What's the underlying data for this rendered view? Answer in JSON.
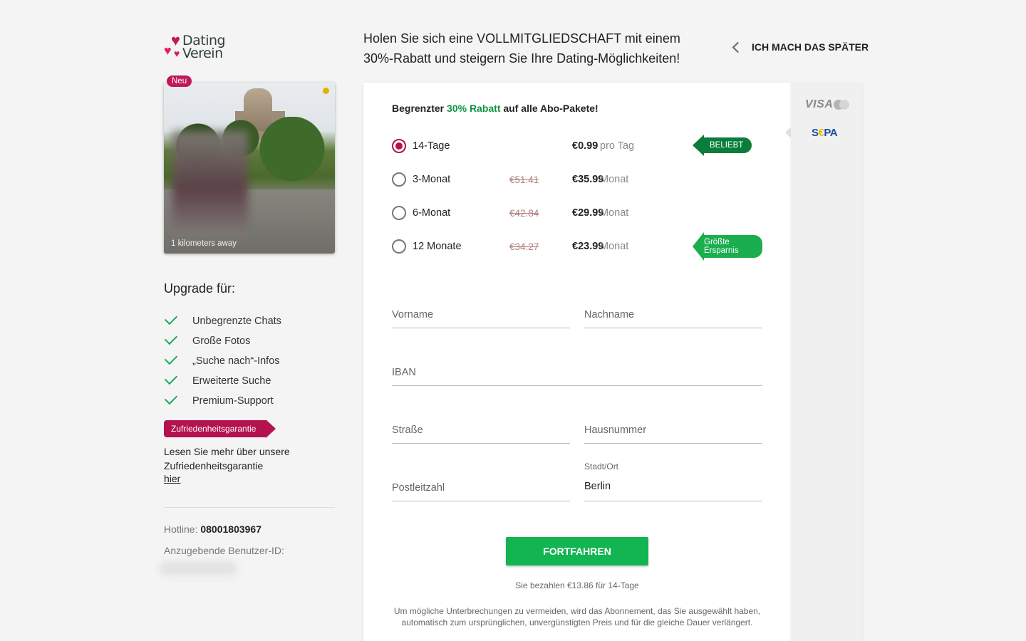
{
  "brand": {
    "logo_text_line1": "Dating",
    "logo_text_line2": "Verein"
  },
  "profile": {
    "badge": "Neu",
    "distance": "1 kilometers away"
  },
  "upgrade": {
    "title": "Upgrade für:",
    "features": [
      "Unbegrenzte Chats",
      "Große Fotos",
      "„Suche nach“-Infos",
      "Erweiterte Suche",
      "Premium-Support"
    ],
    "guarantee_badge": "Zufriedenheitsgarantie",
    "guarantee_text": "Lesen Sie mehr über unsere Zufriedenheitsgarantie",
    "guarantee_link": "hier"
  },
  "contact": {
    "hotline_label": "Hotline:",
    "hotline_number": "08001803967",
    "user_id_label": "Anzugebende Benutzer-ID:"
  },
  "header": {
    "headline": "Holen Sie sich eine VOLLMITGLIEDSCHAFT mit einem 30%-Rabatt und steigern Sie Ihre Dating-Möglichkeiten!",
    "later_button": "ICH MACH DAS SPÄTER"
  },
  "promo": {
    "prefix": "Begrenzter ",
    "highlight": "30% Rabatt",
    "suffix": " auf alle Abo-Pakete!"
  },
  "plans": [
    {
      "name": "14-Tage",
      "old_price": "",
      "price": "€0.99",
      "unit": "pro Tag",
      "selected": true
    },
    {
      "name": "3-Monat",
      "old_price": "€51.41",
      "price": "€35.99",
      "unit": "Monat",
      "selected": false
    },
    {
      "name": "6-Monat",
      "old_price": "€42.84",
      "price": "€29.99",
      "unit": "Monat",
      "selected": false
    },
    {
      "name": "12 Monate",
      "old_price": "€34.27",
      "price": "€23.99",
      "unit": "Monat",
      "selected": false
    }
  ],
  "tags": {
    "popular": "BELIEBT",
    "savings_line1": "Größte",
    "savings_line2": "Ersparnis"
  },
  "payment_methods": {
    "visa": "VISA",
    "sepa_s": "S",
    "sepa_euro": "€",
    "sepa_rest": "PA"
  },
  "form": {
    "first_name_placeholder": "Vorname",
    "last_name_placeholder": "Nachname",
    "iban_placeholder": "IBAN",
    "street_placeholder": "Straße",
    "house_number_placeholder": "Hausnummer",
    "postal_code_placeholder": "Postleitzahl",
    "city_label": "Stadt/Ort",
    "city_value": "Berlin"
  },
  "submit": {
    "button": "FORTFAHREN",
    "pay_note": "Sie bezahlen  €13.86 für 14-Tage",
    "renew_note": "Um mögliche Unterbrechungen zu vermeiden, wird das Abonnement, das Sie ausgewählt haben, automatisch zum ursprünglichen, unvergünstigten Preis und für die gleiche Dauer verlängert."
  },
  "colors": {
    "brand": "#c2185b",
    "accent_green": "#12b551",
    "popular_green": "#0a7d3a"
  }
}
